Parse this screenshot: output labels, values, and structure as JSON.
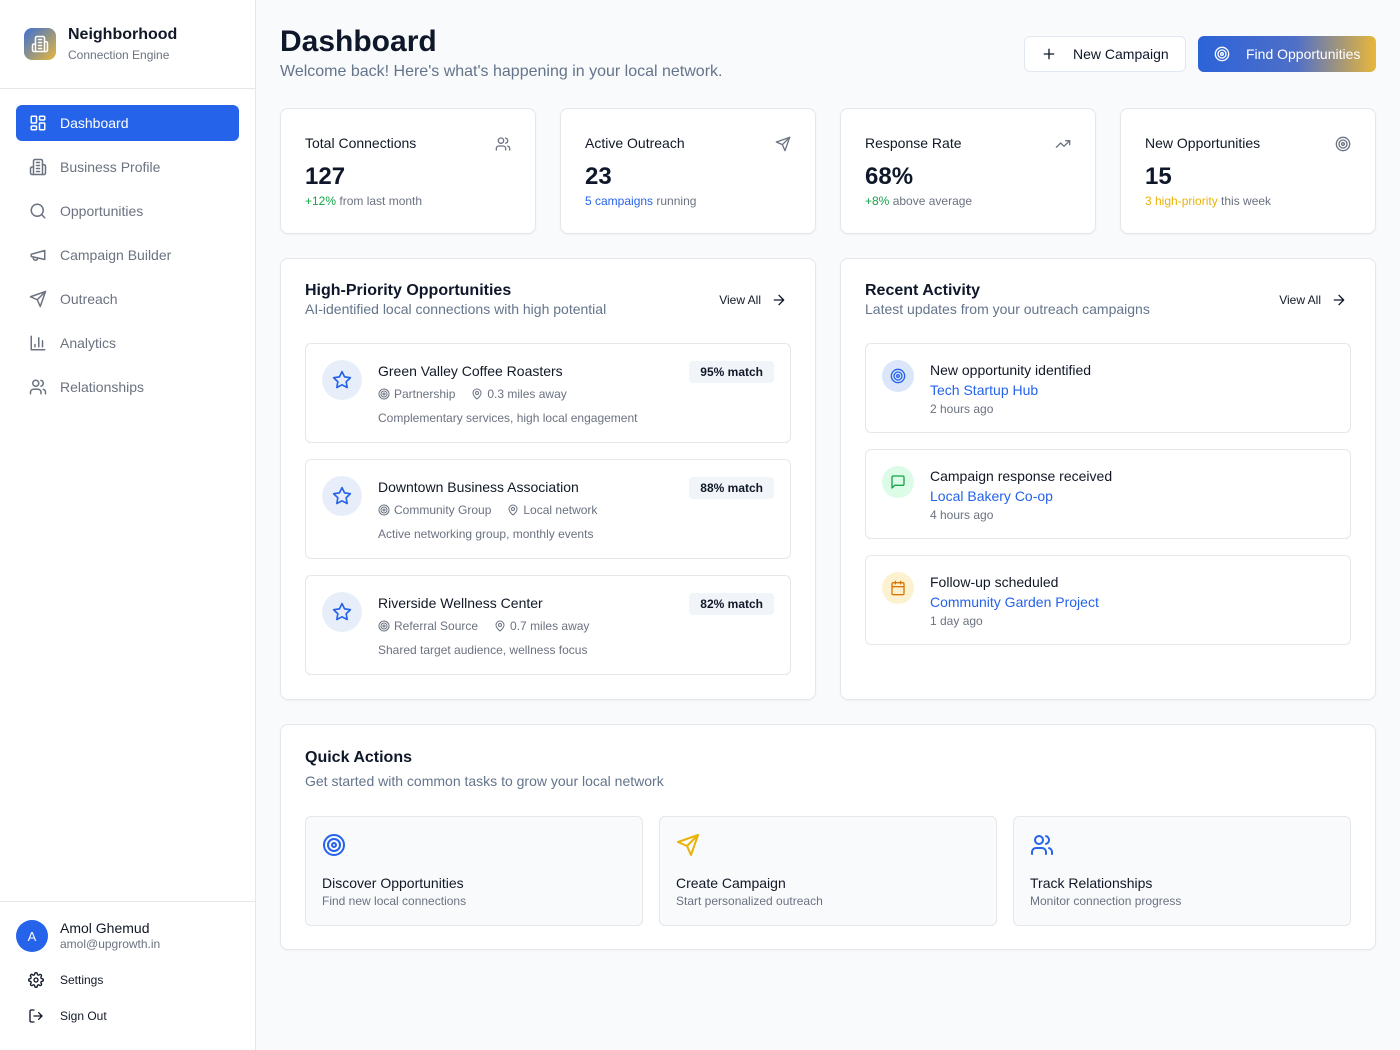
{
  "brand": {
    "title": "Neighborhood",
    "subtitle": "Connection Engine",
    "logo_icon": "building-icon"
  },
  "nav": {
    "items": [
      {
        "label": "Dashboard",
        "icon": "grid-icon",
        "active": true
      },
      {
        "label": "Business Profile",
        "icon": "building-icon"
      },
      {
        "label": "Opportunities",
        "icon": "search-icon"
      },
      {
        "label": "Campaign Builder",
        "icon": "megaphone-icon"
      },
      {
        "label": "Outreach",
        "icon": "send-icon"
      },
      {
        "label": "Analytics",
        "icon": "bar-chart-icon"
      },
      {
        "label": "Relationships",
        "icon": "users-icon"
      }
    ]
  },
  "user": {
    "initial": "A",
    "name": "Amol Ghemud",
    "email": "amol@upgrowth.in"
  },
  "footer_links": {
    "settings": "Settings",
    "sign_out": "Sign Out"
  },
  "header": {
    "title": "Dashboard",
    "subtitle": "Welcome back! Here's what's happening in your local network.",
    "new_campaign": "New Campaign",
    "find_opportunities": "Find Opportunities"
  },
  "stats": [
    {
      "label": "Total Connections",
      "value": "127",
      "note_highlight": "+12%",
      "note_rest": " from last month",
      "icon": "users-icon"
    },
    {
      "label": "Active Outreach",
      "value": "23",
      "note_highlight": "5 campaigns",
      "note_rest": " running",
      "icon": "send-icon"
    },
    {
      "label": "Response Rate",
      "value": "68%",
      "note_highlight": "+8%",
      "note_rest": " above average",
      "icon": "trending-up-icon"
    },
    {
      "label": "New Opportunities",
      "value": "15",
      "note_highlight": "3 high-priority",
      "note_rest": " this week",
      "icon": "target-icon"
    }
  ],
  "opportunities": {
    "title": "High-Priority Opportunities",
    "subtitle": "AI-identified local connections with high potential",
    "view_all": "View All",
    "items": [
      {
        "name": "Green Valley Coffee Roasters",
        "type": "Partnership",
        "location": "0.3 miles away",
        "desc": "Complementary services, high local engagement",
        "match": "95% match"
      },
      {
        "name": "Downtown Business Association",
        "type": "Community Group",
        "location": "Local network",
        "desc": "Active networking group, monthly events",
        "match": "88% match"
      },
      {
        "name": "Riverside Wellness Center",
        "type": "Referral Source",
        "location": "0.7 miles away",
        "desc": "Shared target audience, wellness focus",
        "match": "82% match"
      }
    ]
  },
  "activity": {
    "title": "Recent Activity",
    "subtitle": "Latest updates from your outreach campaigns",
    "view_all": "View All",
    "items": [
      {
        "title": "New opportunity identified",
        "link": "Tech Startup Hub",
        "time": "2 hours ago",
        "icon": "target-icon"
      },
      {
        "title": "Campaign response received",
        "link": "Local Bakery Co-op",
        "time": "4 hours ago",
        "icon": "message-icon"
      },
      {
        "title": "Follow-up scheduled",
        "link": "Community Garden Project",
        "time": "1 day ago",
        "icon": "calendar-icon"
      }
    ]
  },
  "quick_actions": {
    "title": "Quick Actions",
    "subtitle": "Get started with common tasks to grow your local network",
    "items": [
      {
        "title": "Discover Opportunities",
        "sub": "Find new local connections",
        "icon": "target-icon"
      },
      {
        "title": "Create Campaign",
        "sub": "Start personalized outreach",
        "icon": "send-icon"
      },
      {
        "title": "Track Relationships",
        "sub": "Monitor connection progress",
        "icon": "users-icon"
      }
    ]
  },
  "colors": {
    "primary": "#2563eb",
    "accent": "#e8b73a",
    "positive": "#16a34a",
    "warning": "#eab308"
  }
}
